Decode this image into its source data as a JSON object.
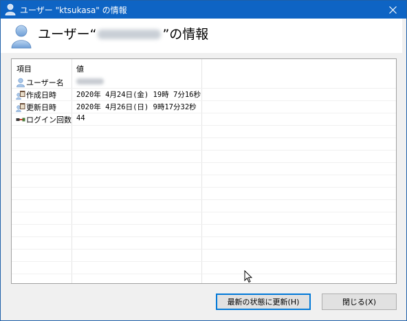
{
  "window": {
    "title": "ユーザー \"ktsukasa\" の情報",
    "close_icon": "close-icon"
  },
  "header": {
    "heading_prefix": "ユーザー“",
    "heading_suffix": "”の情報",
    "icon": "user-icon"
  },
  "list": {
    "columns": [
      "項目",
      "値"
    ],
    "rows": [
      {
        "key": "ユーザー名",
        "icon": "user-icon",
        "value": ""
      },
      {
        "key": "作成日時",
        "icon": "calendar-user-icon",
        "value": "2020年 4月24日(金) 19時 7分16秒"
      },
      {
        "key": "更新日時",
        "icon": "calendar-user-icon",
        "value": "2020年 4月26日(日)  9時17分32秒"
      },
      {
        "key": "ログイン回数",
        "icon": "login-key-icon",
        "value": "44"
      }
    ]
  },
  "buttons": {
    "refresh": "最新の状態に更新(H)",
    "close": "閉じる(X)"
  },
  "colors": {
    "titlebar": "#0e64c4",
    "focus_border": "#0078d7"
  }
}
